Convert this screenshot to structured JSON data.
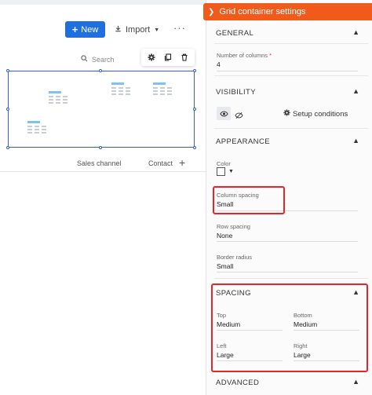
{
  "toolbar": {
    "new_label": "New",
    "import_label": "Import",
    "more_label": "···"
  },
  "search": {
    "placeholder": "Search"
  },
  "table": {
    "columns": [
      "Sales channel",
      "Contact"
    ]
  },
  "panel": {
    "title": "Grid container settings",
    "general": {
      "title": "GENERAL",
      "columns_label": "Number of columns",
      "required_mark": "*",
      "columns_value": "4"
    },
    "visibility": {
      "title": "VISIBILITY",
      "setup_label": "Setup conditions"
    },
    "appearance": {
      "title": "APPEARANCE",
      "color_label": "Color",
      "column_spacing_label": "Column spacing",
      "column_spacing_value": "Small",
      "row_spacing_label": "Row spacing",
      "row_spacing_value": "None",
      "border_radius_label": "Border radius",
      "border_radius_value": "Small"
    },
    "spacing": {
      "title": "SPACING",
      "top_label": "Top",
      "top_value": "Medium",
      "bottom_label": "Bottom",
      "bottom_value": "Medium",
      "left_label": "Left",
      "left_value": "Large",
      "right_label": "Right",
      "right_value": "Large"
    },
    "advanced": {
      "title": "ADVANCED"
    }
  },
  "colors": {
    "accent": "#f05a1a",
    "primary_button": "#1f6fe0",
    "selection": "#3a5fc2",
    "highlight": "#e3262d"
  }
}
